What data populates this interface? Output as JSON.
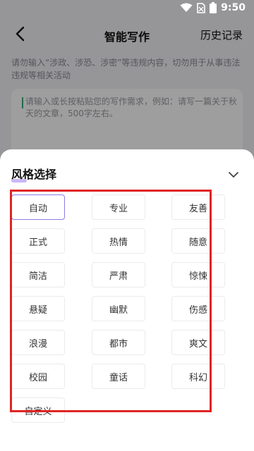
{
  "status_bar": {
    "time": "9:50",
    "icons": [
      "wifi-icon",
      "no-sim-icon",
      "battery-icon"
    ]
  },
  "nav": {
    "back_icon": "back-arrow-icon",
    "title": "智能写作",
    "history_label": "历史记录"
  },
  "notice": "请勿输入“涉政、涉恐、涉密”等违规内容，切勿用于从事违法违规等相关活动",
  "input": {
    "placeholder": "请输入或长按粘贴您的写作需求，例如：请写一篇关于秋天的文章，500字左右。"
  },
  "sheet": {
    "title": "风格选择",
    "collapse_icon": "chevron-down-icon",
    "selected_style": "自动",
    "styles": [
      "自动",
      "专业",
      "友善",
      "正式",
      "热情",
      "随意",
      "简洁",
      "严肃",
      "惊悚",
      "悬疑",
      "幽默",
      "伤感",
      "浪漫",
      "都市",
      "爽文",
      "校园",
      "童话",
      "科幻",
      "自定义"
    ]
  },
  "colors": {
    "selected_border": "#8e7be6",
    "highlight": "#e02424",
    "accent_underline": "#c9b8f5"
  }
}
